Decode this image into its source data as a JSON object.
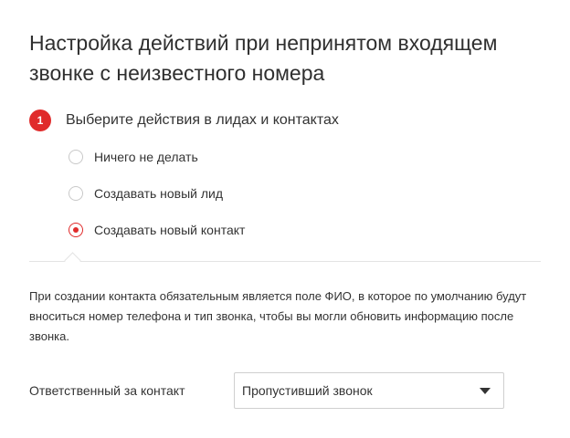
{
  "title": "Настройка действий при непринятом входящем звонке с неизвестного номера",
  "step": {
    "number": "1",
    "title": "Выберите действия в лидах и контактах",
    "accent_color": "#e02b2b"
  },
  "options": [
    {
      "label": "Ничего не делать",
      "checked": false
    },
    {
      "label": "Создавать новый лид",
      "checked": false
    },
    {
      "label": "Создавать новый контакт",
      "checked": true
    }
  ],
  "description": "При создании контакта обязательным является поле ФИО, в которое по умолчанию будут вноситься номер телефона и тип звонка, чтобы вы могли обновить информацию после звонка.",
  "responsible": {
    "label": "Ответственный за контакт",
    "selected": "Пропустивший звонок",
    "arrow_icon": "caret-down-icon"
  }
}
